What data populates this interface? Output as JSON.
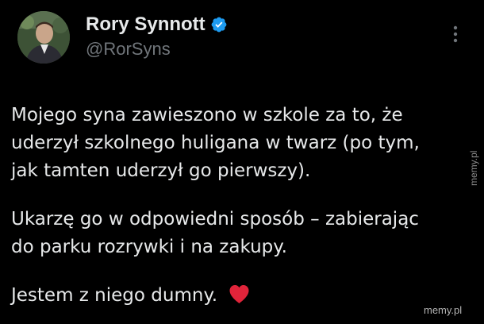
{
  "author": {
    "display_name": "Rory Synnott",
    "handle": "@RorSyns",
    "verified": true
  },
  "tweet": {
    "paragraphs": [
      [
        "Mojego syna zawieszono w szkole za to, że",
        "uderzył szkolnego huligana w twarz (po tym,",
        "jak tamten uderzył go pierwszy)."
      ],
      [
        "Ukarzę go w odpowiedni sposób – zabierając",
        "do parku rozrywki i na zakupy."
      ],
      [
        "Jestem z niego dumny."
      ]
    ],
    "emoji": "red-heart"
  },
  "watermarks": {
    "side": "memy.pl",
    "corner": "memy.pl"
  },
  "colors": {
    "background": "#000000",
    "text_primary": "#e7e9ea",
    "text_secondary": "#71767b",
    "verified_badge": "#1d9bf0",
    "heart": "#e0243a"
  },
  "icons": {
    "verified": "verified-badge-icon",
    "more": "more-options-icon",
    "heart": "red-heart-icon"
  }
}
